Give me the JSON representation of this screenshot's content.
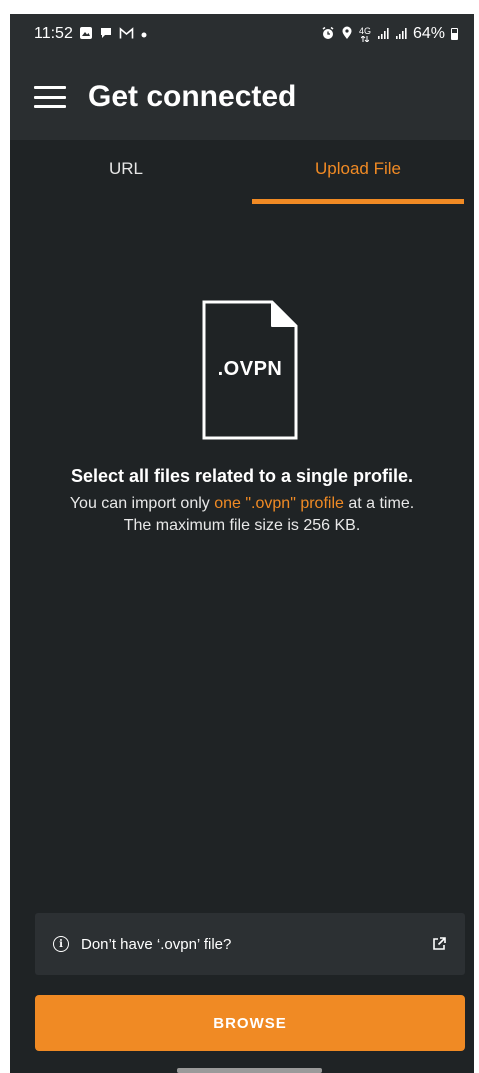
{
  "status_bar": {
    "time": "11:52",
    "battery": "64%",
    "network": "4G",
    "left_icons": [
      "gallery-icon",
      "chat-icon",
      "gmail-icon",
      "dot-icon"
    ],
    "right_icons": [
      "alarm-icon",
      "location-icon",
      "network-4g-icon",
      "signal-icon",
      "signal-icon",
      "battery-icon"
    ]
  },
  "app_bar": {
    "title": "Get connected",
    "menu_icon": "hamburger-menu-icon"
  },
  "tabs": [
    {
      "label": "URL",
      "active": false
    },
    {
      "label": "Upload File",
      "active": true
    }
  ],
  "file_icon": {
    "label": ".OVPN",
    "icon": "document-icon"
  },
  "info": {
    "title": "Select all files related to a single profile.",
    "line1_prefix": "You can import only ",
    "line1_accent": "one \".ovpn\" profile",
    "line1_suffix": " at a time.",
    "line2": "The maximum file size is 256 KB."
  },
  "hint": {
    "text": "Don’t have ‘.ovpn’ file?",
    "left_icon": "info-icon",
    "right_icon": "external-link-icon"
  },
  "browse_button": {
    "label": "BROWSE"
  },
  "colors": {
    "accent": "#f08a24",
    "background": "#1f2325",
    "app_bar": "#2a2e30",
    "hint_bg": "#2c3033"
  }
}
